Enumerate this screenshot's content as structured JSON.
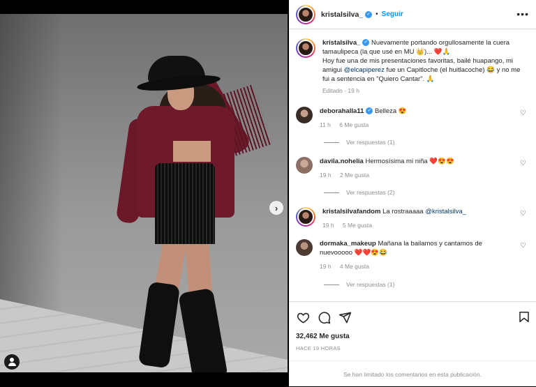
{
  "header": {
    "username": "kristalsilva_",
    "separator": "•",
    "follow_label": "Seguir",
    "more_label": "•••"
  },
  "caption": {
    "username": "kristalsilva_",
    "text_line1": "Nuevamente portando orgullosamente la cuera tamaulipeca (la que usé en MU 👑)... ❤️🙏",
    "text_line2": "Hoy fue una de mis presentaciones favoritas, bailé huapango, mi amigui",
    "mention": "@elcapiperez",
    "text_line3": "fue un Capitloche (el huitlacoche) 😂 y no me fui a sentencia en \"Quiero Cantar\". 🙏",
    "edited": "Editado",
    "time": "19 h"
  },
  "comments": [
    {
      "username": "deborahalla11",
      "verified": true,
      "text": "Belleza 😍",
      "time": "11 h",
      "likes": "6 Me gusta",
      "replies": "Ver respuestas (1)",
      "avatar_color": "#3a2c26"
    },
    {
      "username": "davila.nohelia",
      "verified": false,
      "text": "Hermosísima mi niña ❤️😍😍",
      "time": "19 h",
      "likes": "2 Me gusta",
      "replies": "Ver respuestas (2)",
      "avatar_color": "#8a6f62"
    },
    {
      "username": "kristalsilvafandom",
      "verified": false,
      "text": "La rostraaaaa",
      "mention": "@kristalsilva_",
      "time": "19 h",
      "likes": "5 Me gusta",
      "replies": "",
      "avatar_color": "#5a4038"
    },
    {
      "username": "dormaka_makeup",
      "verified": false,
      "text": "Mañana la bailamos y cantamos de nuevooooo ❤️❤️😍😂",
      "time": "19 h",
      "likes": "4 Me gusta",
      "replies": "Ver respuestas (1)",
      "avatar_color": "#4d3b33"
    }
  ],
  "actions": {
    "likes": "32,462 Me gusta",
    "ago": "HACE 19 HORAS",
    "limited": "Se han limitado los comentarios en esta publicación."
  },
  "icons": {
    "heart": "heart-icon",
    "comment": "comment-icon",
    "share": "share-icon",
    "bookmark": "bookmark-icon",
    "verified": "verified-icon",
    "next": "chevron-right-icon",
    "tag": "user-tag-icon"
  },
  "colors": {
    "accent": "#0095f6",
    "verified": "#3897f0",
    "text": "#262626",
    "muted": "#8e8e8e"
  }
}
